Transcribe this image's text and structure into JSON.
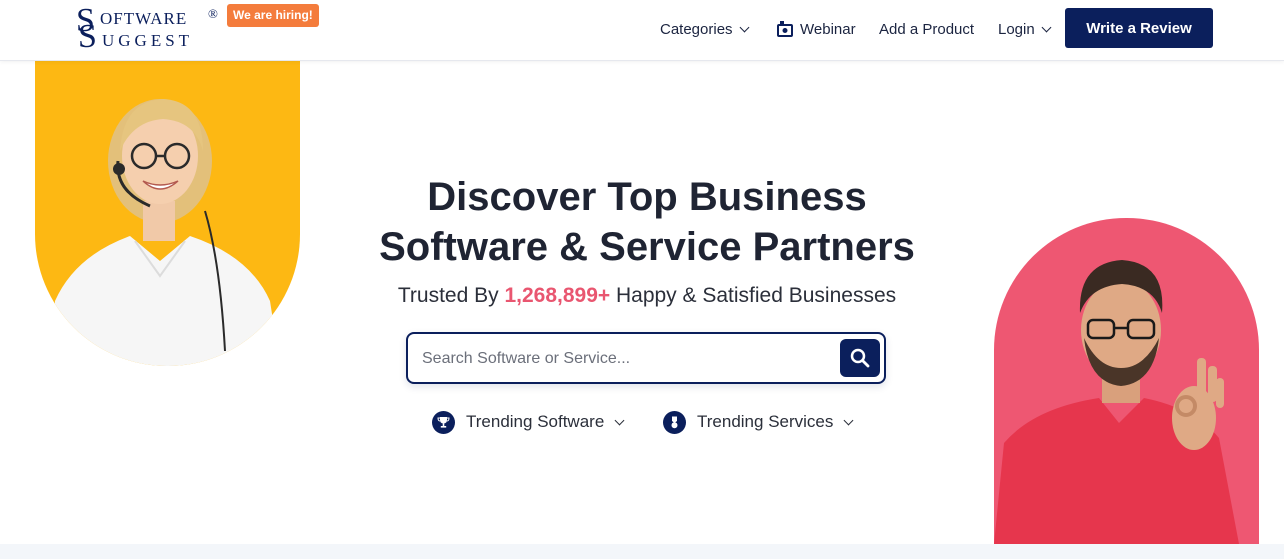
{
  "logo": {
    "first_letter_top": "S",
    "row1": "OFTWARE",
    "first_letter_bottom": "S",
    "row2": "UGGEST",
    "registered": "®"
  },
  "hiring_badge": "We are hiring!",
  "nav": {
    "categories": "Categories",
    "webinar": "Webinar",
    "add_product": "Add a Product",
    "login": "Login",
    "write_review": "Write a Review"
  },
  "hero": {
    "headline_line1": "Discover Top Business",
    "headline_line2": "Software & Service Partners",
    "trusted_prefix": "Trusted By ",
    "trusted_count": "1,268,899+",
    "trusted_suffix": " Happy & Satisfied Businesses"
  },
  "search": {
    "placeholder": "Search Software or Service..."
  },
  "trending": {
    "software": "Trending Software",
    "services": "Trending Services"
  },
  "colors": {
    "brand_navy": "#0b1f5c",
    "accent_pink": "#e95670",
    "hiring_orange": "#f47c3c",
    "left_panel_yellow": "#fdb813",
    "right_panel_pink": "#ee5772"
  },
  "icons": {
    "webinar": "webinar-icon",
    "search": "search-icon",
    "trophy": "trophy-icon",
    "medal": "medal-icon"
  }
}
